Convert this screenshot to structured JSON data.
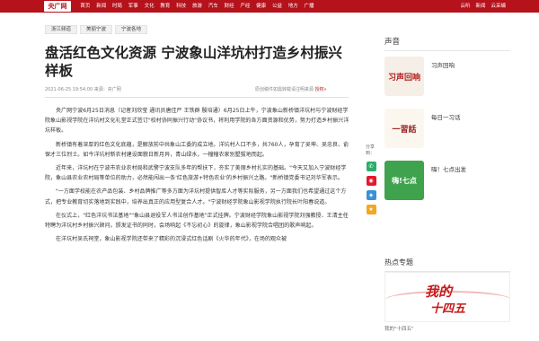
{
  "header": {
    "logo": "央广网",
    "nav": [
      "首页",
      "新闻",
      "时局",
      "军事",
      "文化",
      "教育",
      "科技",
      "旅游",
      "汽车",
      "财经",
      "产经",
      "健康",
      "公益",
      "地方",
      "广播"
    ],
    "right": [
      "云听",
      "新闻",
      "云采编"
    ]
  },
  "breadcrumbs": [
    "浙江频道",
    "美丽宁波",
    "宁波各地"
  ],
  "article": {
    "title": "盘活红色文化资源 宁波象山洋坑村打造乡村振兴样板",
    "meta": "2021-06-25 19:54:00  来源：央广网",
    "meta_right": "原创稿件如需转载请注明来源",
    "meta_right_link": "授权»",
    "paragraphs": [
      "央广网宁波6月25日消息（记者刘欣莹 通讯员唐佳严 王铁群 殷培通）6月25日上午，宁波象山新桥镇洋坑村与宁波财经学院象山影视学院在洋坑村文化礼堂正式签订\"校村协同振兴行动\"协议书，将利用学院的各方面资源和优势，努力打造乡村振兴洋坑样板。",
      "新桥镇有着深厚的红色文化底蕴，是解放前中共象山工委的成立地。洋坑村人口不多，共760人，孕育了吴坤、吴忠良、俞保才三位烈士。如今洋坑村新农村建设面貌日新月异，青山绿水，一幢幢农家别墅拔地而起。",
      "近年来，洋坑村在宁波市农业农村局和武警宁波支队多年的帮扶下，夯实了美丽乡村扎实的基础。\"今天又加入宁波财经学院，象山县农业农村局等单位的助力，必然能闯出一条'红色旅游+特色农业'的乡村振兴之路。\"新桥镇党委书记刘华军表示。",
      "\"一方面学校能在农产品包装、乡村品牌推广等多方面为洋坑村提供智库人才等实际服务，另一方面我们也希望通过这个方式，把专业教育切实落地到实践中，培养出真正的应用型复合人才。\"宁波财经学院象山影视学院执行院长叶阳春说道。",
      "在仪式上，\"红色洋坑书法基地\"\"象山县退役军人书法创作基地\"正式挂牌。宁波财经学院象山影视学院刘强教授、王清主任特聘为洋坑村乡村振兴顾问。颁发证书的同时，会场响起《不忘初心》的旋律，象山影视学院合唱团的歌声响起。",
      "在洋坑村吴氏祠堂，象山影视学院还带来了精彩的沉浸式红色话剧《火华的年代》，在场的观众被"
    ]
  },
  "share": {
    "label": "分享到："
  },
  "sidebar": {
    "heading": "声音",
    "cards": [
      {
        "thumb": "习声回响",
        "title": "习声回响"
      },
      {
        "thumb": "一習話",
        "title": "每日一习话"
      },
      {
        "thumb": "嗨!七点",
        "title": "嗨！七点出发"
      }
    ],
    "hot_heading": "热点专题",
    "hot_big": "我的",
    "hot_big2": "十四五",
    "hot_caption": "我的\"十四五\""
  },
  "colors": {
    "brand": "#b5121b"
  }
}
